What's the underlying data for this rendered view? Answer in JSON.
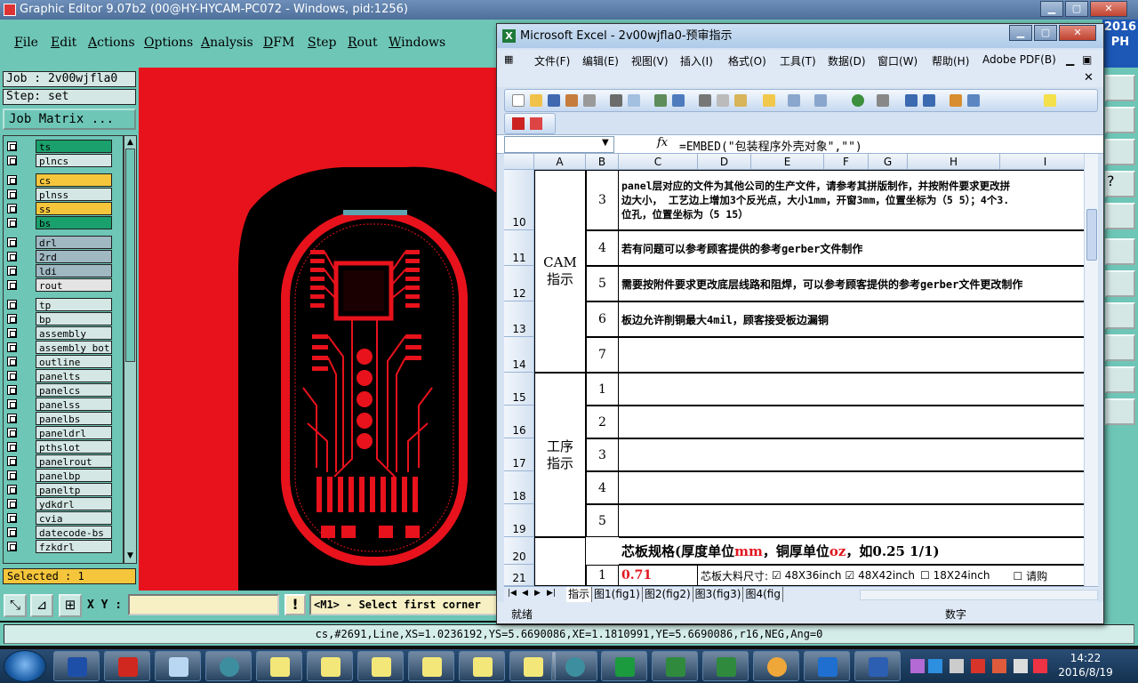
{
  "genesis": {
    "title": "Graphic Editor 9.07b2 (00@HY-HYCAM-PC072 - Windows, pid:1256)",
    "menu": [
      "File",
      "Edit",
      "Actions",
      "Options",
      "Analysis",
      "DFM",
      "Step",
      "Rout",
      "Windows"
    ],
    "job": "Job : 2v00wjfla0",
    "step": "Step: set",
    "job_matrix_button": "Job Matrix ...",
    "layers": [
      {
        "name": "ts",
        "color": "#1aa06d"
      },
      {
        "name": "plncs",
        "color": "#d4e7e4"
      },
      {
        "name": "cs",
        "color": "#f5c63c"
      },
      {
        "name": "plnss",
        "color": "#d4e7e4"
      },
      {
        "name": "ss",
        "color": "#f5c63c"
      },
      {
        "name": "bs",
        "color": "#1aa06d"
      },
      {
        "name": "drl",
        "color": "#9fb8c2"
      },
      {
        "name": "2rd",
        "color": "#9fb8c2"
      },
      {
        "name": "ldi",
        "color": "#9fb8c2"
      },
      {
        "name": "rout",
        "color": "#e4e4e4"
      },
      {
        "name": "tp",
        "color": "#d4e7e4"
      },
      {
        "name": "bp",
        "color": "#d4e7e4"
      },
      {
        "name": "assembly",
        "color": "#d4e7e4"
      },
      {
        "name": "assembly_bot",
        "color": "#d4e7e4"
      },
      {
        "name": "outline",
        "color": "#d4e7e4"
      },
      {
        "name": "panelts",
        "color": "#d4e7e4"
      },
      {
        "name": "panelcs",
        "color": "#d4e7e4"
      },
      {
        "name": "panelss",
        "color": "#d4e7e4"
      },
      {
        "name": "panelbs",
        "color": "#d4e7e4"
      },
      {
        "name": "paneldrl",
        "color": "#d4e7e4"
      },
      {
        "name": "pthslot",
        "color": "#d4e7e4"
      },
      {
        "name": "panelrout",
        "color": "#d4e7e4"
      },
      {
        "name": "panelbp",
        "color": "#d4e7e4"
      },
      {
        "name": "paneltp",
        "color": "#d4e7e4"
      },
      {
        "name": "ydkdrl",
        "color": "#d4e7e4"
      },
      {
        "name": "cvia",
        "color": "#d4e7e4"
      },
      {
        "name": "datecode-bs",
        "color": "#d4e7e4"
      },
      {
        "name": "fzkdrl",
        "color": "#d4e7e4"
      }
    ],
    "selected": "Selected : 1",
    "xy_label": "X Y :",
    "xy_value": "",
    "warn_symbol": "!",
    "prompt": "<M1> - Select first corner",
    "status": "cs,#2691,Line,XS=1.0236192,YS=5.6690086,XE=1.1810991,YE=5.6690086,r16,NEG,Ang=0",
    "right_label": "2016 PH",
    "canvas_colors": {
      "copper": "#e8121c",
      "background": "#000000",
      "fill": "#e8121c"
    }
  },
  "excel": {
    "title": "Microsoft Excel - 2v00wjfla0-预审指示",
    "menu": [
      "文件(F)",
      "编辑(E)",
      "视图(V)",
      "插入(I)",
      "格式(O)",
      "工具(T)",
      "数据(D)",
      "窗口(W)",
      "帮助(H)",
      "Adobe PDF(B)"
    ],
    "name_box": "",
    "fx": "fx",
    "formula": "=EMBED(\"包装程序外壳对象\",\"\")",
    "columns": [
      "A",
      "B",
      "C",
      "D",
      "E",
      "F",
      "G",
      "H",
      "I"
    ],
    "rows": [
      "10",
      "11",
      "12",
      "13",
      "14",
      "15",
      "16",
      "17",
      "18",
      "19",
      "20",
      "21"
    ],
    "cam_label": "CAM\n指示",
    "process_label": "工序\n指示",
    "cam_items": [
      {
        "no": "3",
        "text": "panel层对应的文件为其他公司的生产文件，请参考其拼版制作，并按附件要求更改拼\n边大小， 工艺边上增加3个反光点，大小1mm，开窗3mm，位置坐标为（5 5）；4个3.\n位孔，位置坐标为（5 15）"
      },
      {
        "no": "4",
        "text": "若有问题可以参考顾客提供的参考gerber文件制作"
      },
      {
        "no": "5",
        "text": "需要按附件要求更改底层线路和阻焊，可以参考顾客提供的参考gerber文件更改制作"
      },
      {
        "no": "6",
        "text": "板边允许削铜最大4mil，顾客接受板边漏铜"
      },
      {
        "no": "7",
        "text": ""
      }
    ],
    "process_items": [
      {
        "no": "1",
        "text": ""
      },
      {
        "no": "2",
        "text": ""
      },
      {
        "no": "3",
        "text": ""
      },
      {
        "no": "4",
        "text": ""
      },
      {
        "no": "5",
        "text": ""
      }
    ],
    "spec_title_prefix": "芯板规格(厚度单位",
    "spec_mm": "mm",
    "spec_mid": "，铜厚单位",
    "spec_oz": "oz",
    "spec_example": "，如0.25 1/1)",
    "row21_no": "1",
    "row21_thickness": "0.71",
    "row21_label": "芯板大料尺寸:",
    "row21_opts": [
      "☑ 48X36inch",
      "☑ 48X42inch",
      "☐ 18X24inch",
      "☐ 请购"
    ],
    "sheet_tabs": [
      "指示",
      "图1(fig1)",
      "图2(fig2)",
      "图3(fig3)",
      "图4(fig"
    ],
    "status_ready": "就绪",
    "status_num": "数字"
  },
  "taskbar": {
    "items": [
      "save-app",
      "red-app",
      "notepad",
      "camera-app",
      "excel-1",
      "excel-2",
      "excel-3",
      "excel-4",
      "excel-5",
      "genesis-app",
      "green-p",
      "excel-6",
      "excel-7",
      "shell-app",
      "f-app",
      "word"
    ],
    "time": "14:22",
    "date": "2016/8/19"
  }
}
